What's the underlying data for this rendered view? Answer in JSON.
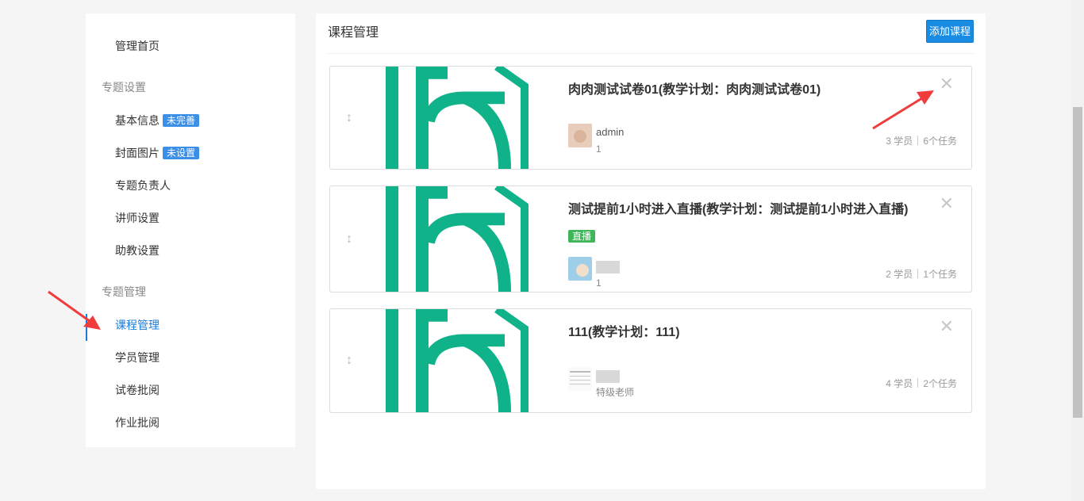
{
  "sidebar": {
    "home": "管理首页",
    "section_settings": "专题设置",
    "basic_info": "基本信息",
    "basic_info_badge": "未完善",
    "cover_image": "封面图片",
    "cover_image_badge": "未设置",
    "owner": "专题负责人",
    "lecturer": "讲师设置",
    "assistant": "助教设置",
    "section_manage": "专题管理",
    "course_manage": "课程管理",
    "student_manage": "学员管理",
    "exam_review": "试卷批阅",
    "homework_review": "作业批阅"
  },
  "main": {
    "title": "课程管理",
    "add_button": "添加课程"
  },
  "courses": [
    {
      "title": "肉肉测试试卷01(教学计划：肉肉测试试卷01)",
      "teacher_name": "admin",
      "teacher_sub": "1",
      "students": "3 学员",
      "tasks": "6个任务"
    },
    {
      "title": "测试提前1小时进入直播(教学计划：测试提前1小时进入直播)",
      "tag": "直播",
      "teacher_sub": "1",
      "students": "2 学员",
      "tasks": "1个任务"
    },
    {
      "title": "111(教学计划：111)",
      "teacher_sub": "特级老师",
      "students": "4 学员",
      "tasks": "2个任务"
    }
  ],
  "icons": {
    "drag": "drag-handle-icon",
    "close": "close-icon",
    "arrow": "red-arrow-annotation"
  },
  "colors": {
    "accent": "#1a7bd9",
    "live_tag": "#3fb65a",
    "cover_green": "#10b389",
    "annotation_red": "#f03c3c"
  }
}
